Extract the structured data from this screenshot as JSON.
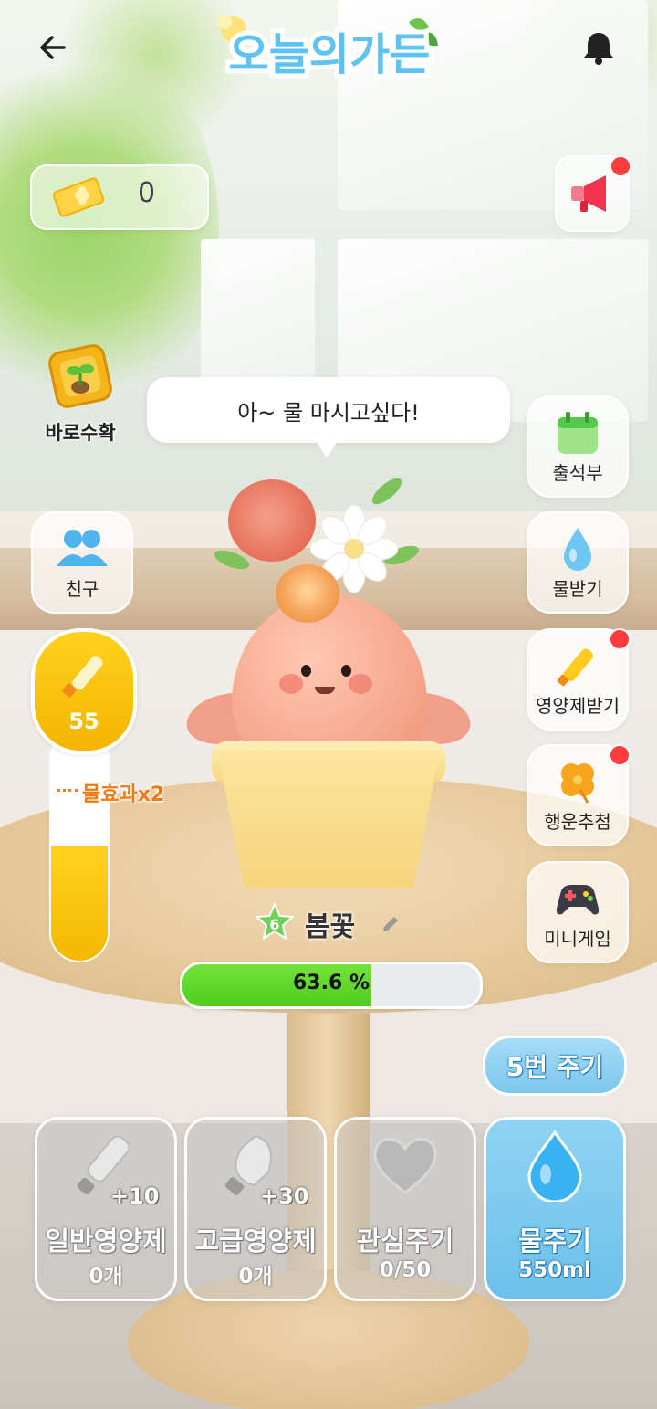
{
  "header": {
    "back_icon": "arrow-left-icon",
    "logo_text": "오늘의가든",
    "bell_icon": "bell-icon"
  },
  "ticket": {
    "icon": "clover-ticket-icon",
    "count": "0"
  },
  "megaphone": {
    "icon": "megaphone-icon",
    "has_alert": true
  },
  "quick_harvest": {
    "label": "바로수확",
    "icon": "sprout-tile-icon"
  },
  "speech_bubble": {
    "text": "아~ 물 마시고싶다!"
  },
  "friends": {
    "label": "친구",
    "icon": "people-icon"
  },
  "side_menu": [
    {
      "label": "출석부",
      "icon": "calendar-icon",
      "alert": false
    },
    {
      "label": "물받기",
      "icon": "water-drop-icon",
      "alert": false
    },
    {
      "label": "영양제받기",
      "icon": "nutrient-bottle-icon",
      "alert": true
    },
    {
      "label": "행운추첨",
      "icon": "clover-icon",
      "alert": true
    },
    {
      "label": "미니게임",
      "icon": "gamepad-icon",
      "alert": false
    }
  ],
  "gauge": {
    "value": "55",
    "effect_label": "물효과x2",
    "fill_fraction": 0.5,
    "icon": "nutrient-bottle-icon"
  },
  "plant": {
    "level": "6",
    "name": "봄꽃",
    "edit_icon": "pencil-icon",
    "progress_text": "63.6 %",
    "progress_percent": 63.6
  },
  "give_button": {
    "label": "5번 주기"
  },
  "actions": [
    {
      "name": "일반영양제",
      "sub": "0개",
      "plus": "+10",
      "icon": "nutrient-bottle-icon",
      "active": false
    },
    {
      "name": "고급영양제",
      "sub": "0개",
      "plus": "+30",
      "icon": "premium-nutrient-icon",
      "active": false
    },
    {
      "name": "관심주기",
      "sub": "0/50",
      "plus": "",
      "icon": "heart-icon",
      "active": false
    },
    {
      "name": "물주기",
      "sub": "550ml",
      "plus": "",
      "icon": "water-drop-icon",
      "active": true
    }
  ],
  "colors": {
    "accent_green": "#5fd62a",
    "gauge_yellow": "#f9c414",
    "water_blue": "#7cc7ee",
    "alert_red": "#ff3b3b"
  }
}
